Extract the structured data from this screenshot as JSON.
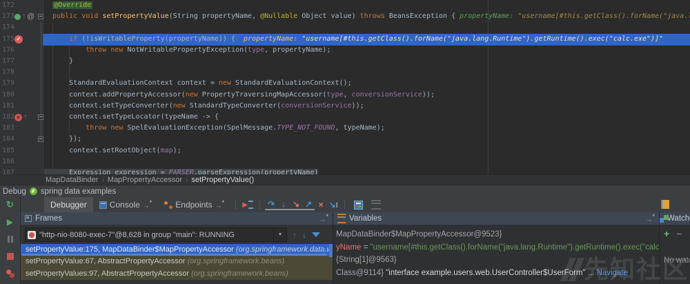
{
  "colors": {
    "editor_bg": "#2B2B2B",
    "gutter_bg": "#313335",
    "exec_line": "#2D65C9",
    "selected_frame": "#3164C6",
    "library_frame": "#4B4836",
    "panel_header": "#3D4754",
    "keyword": "#CC7832",
    "string": "#6A9758",
    "breakpoint": "#DB5C5C",
    "link": "#5394EC"
  },
  "icons": {
    "rerun": "↻",
    "resume": "▶",
    "exec_point": "▶",
    "step_over": "↷",
    "step_into": "↓",
    "force_step_into": "↘",
    "step_out": "↗",
    "drop_frame": "×",
    "run_to_cursor": "↘",
    "cursor_i": "I",
    "up": "↑",
    "down": "↓",
    "dropdown": "▼",
    "export_arrow": "→",
    "asterisk": "*",
    "check": "✓",
    "cross": "×",
    "at": "@",
    "breadcrumb_sep": "›",
    "plus": "+",
    "minus": "−"
  },
  "editor": {
    "exec_line_index": 3,
    "lines": [
      {
        "n": 172,
        "tokens": [
          [
            "p",
            "  "
          ],
          [
            "ahl",
            "@Override"
          ]
        ]
      },
      {
        "n": 173,
        "icons": [
          "override",
          "at"
        ],
        "fold": true,
        "tokens": [
          [
            "p",
            "  "
          ],
          [
            "k",
            "public"
          ],
          [
            "p",
            " "
          ],
          [
            "k",
            "void"
          ],
          [
            "p",
            " "
          ],
          [
            "m",
            "setPropertyValue"
          ],
          [
            "p",
            "(String propertyName, "
          ],
          [
            "a",
            "@Nullable"
          ],
          [
            "p",
            " Object value) "
          ],
          [
            "k",
            "throws"
          ],
          [
            "p",
            " BeansException { "
          ],
          [
            "hl1",
            "propertyName: "
          ],
          [
            "hv1",
            "\"username[#this.getClass().forName(\"java.lang.Runti"
          ]
        ]
      },
      {
        "n": 174,
        "tokens": []
      },
      {
        "n": 175,
        "icons": [
          "bp"
        ],
        "exec": true,
        "tokens": [
          [
            "p",
            "      "
          ],
          [
            "k",
            "if"
          ],
          [
            "p",
            " (!isWritableProperty(propertyName)) {  "
          ],
          [
            "hl2",
            "propertyName: "
          ],
          [
            "hv2",
            "\"username[#this.getClass().forName(\"java.lang.Runtime\").getRuntime().exec(\"calc.exe\")]\""
          ]
        ]
      },
      {
        "n": 176,
        "tokens": [
          [
            "p",
            "          "
          ],
          [
            "k",
            "throw"
          ],
          [
            "p",
            " "
          ],
          [
            "k",
            "new"
          ],
          [
            "p",
            " NotWritablePropertyException("
          ],
          [
            "f",
            "type"
          ],
          [
            "p",
            ", propertyName);"
          ]
        ]
      },
      {
        "n": 177,
        "tokens": [
          [
            "p",
            "      }"
          ]
        ]
      },
      {
        "n": 178,
        "tokens": []
      },
      {
        "n": 179,
        "tokens": [
          [
            "p",
            "      StandardEvaluationContext context = "
          ],
          [
            "k",
            "new"
          ],
          [
            "p",
            " StandardEvaluationContext();"
          ]
        ]
      },
      {
        "n": 180,
        "tokens": [
          [
            "p",
            "      context.addPropertyAccessor("
          ],
          [
            "k",
            "new"
          ],
          [
            "p",
            " PropertyTraversingMapAccessor("
          ],
          [
            "f",
            "type"
          ],
          [
            "p",
            ", "
          ],
          [
            "f",
            "conversionService"
          ],
          [
            "p",
            "));"
          ]
        ]
      },
      {
        "n": 181,
        "tokens": [
          [
            "p",
            "      context.setTypeConverter("
          ],
          [
            "k",
            "new"
          ],
          [
            "p",
            " StandardTypeConverter("
          ],
          [
            "f",
            "conversionService"
          ],
          [
            "p",
            "));"
          ]
        ]
      },
      {
        "n": 182,
        "icons": [
          "mbp"
        ],
        "fold": true,
        "tokens": [
          [
            "p",
            "      context.setTypeLocator(typeName -> {"
          ]
        ]
      },
      {
        "n": 183,
        "tokens": [
          [
            "p",
            "          "
          ],
          [
            "k",
            "throw"
          ],
          [
            "p",
            " "
          ],
          [
            "k",
            "new"
          ],
          [
            "p",
            " SpelEvaluationException(SpelMessage."
          ],
          [
            "ci",
            "TYPE_NOT_FOUND"
          ],
          [
            "p",
            ", typeName);"
          ]
        ]
      },
      {
        "n": 184,
        "fold": true,
        "tokens": [
          [
            "p",
            "      });"
          ]
        ]
      },
      {
        "n": 185,
        "tokens": [
          [
            "p",
            "      context.setRootObject("
          ],
          [
            "f",
            "map"
          ],
          [
            "p",
            ");"
          ]
        ]
      },
      {
        "n": 186,
        "tokens": []
      },
      {
        "n": 187,
        "sel": true,
        "tokens": [
          [
            "p",
            "      Expression expression = "
          ],
          [
            "ci",
            "PARSER"
          ],
          [
            "p",
            ".parseExpression(propertyName)"
          ]
        ]
      }
    ],
    "breadcrumbs": [
      "MapDataBinder",
      "MapPropertyAccessor",
      "setPropertyValue()"
    ]
  },
  "debug": {
    "title": "Debug",
    "subtitle": "spring data examples",
    "tabs": {
      "debugger": "Debugger",
      "console": "Console",
      "endpoints": "Endpoints"
    },
    "frames": {
      "title": "Frames",
      "thread": "\"http-nio-8080-exec-7\"@8,628 in group \"main\": RUNNING",
      "items": [
        {
          "text": "setPropertyValue:175, MapDataBinder$MapPropertyAccessor ",
          "pkg": "(org.springframework.data.web",
          "selected": true
        },
        {
          "text": "setPropertyValue:67, AbstractPropertyAccessor ",
          "pkg": "(org.springframework.beans)",
          "selected": false
        },
        {
          "text": "setPropertyValues:97, AbstractPropertyAccessor ",
          "pkg": "(org.springframework.beans)",
          "selected": false
        }
      ]
    },
    "variables": {
      "title": "Variables",
      "rows": [
        {
          "segs": [
            [
              "ref",
              "MapDataBinder$MapPropertyAccessor@9523}"
            ]
          ]
        },
        {
          "segs": [
            [
              "varname",
              "yName"
            ],
            [
              "plain",
              " = "
            ],
            [
              "string",
              "\"username[#this.getClass().forName(\"java.lang.Runtime\").getRuntime().exec(\"calc.exe\")]\""
            ]
          ]
        },
        {
          "segs": [
            [
              "ref",
              "{String[1]@9563}"
            ]
          ]
        },
        {
          "segs": [
            [
              "ref",
              "Class@9114} "
            ],
            [
              "value",
              "\"interface example.users.web.UserController$UserForm\""
            ],
            [
              "plain",
              " ... "
            ],
            [
              "link",
              "Navigate"
            ]
          ]
        }
      ]
    },
    "watches": {
      "title": "Watches",
      "empty": "No watches"
    }
  },
  "watermark": {
    "text": "先知社区"
  }
}
